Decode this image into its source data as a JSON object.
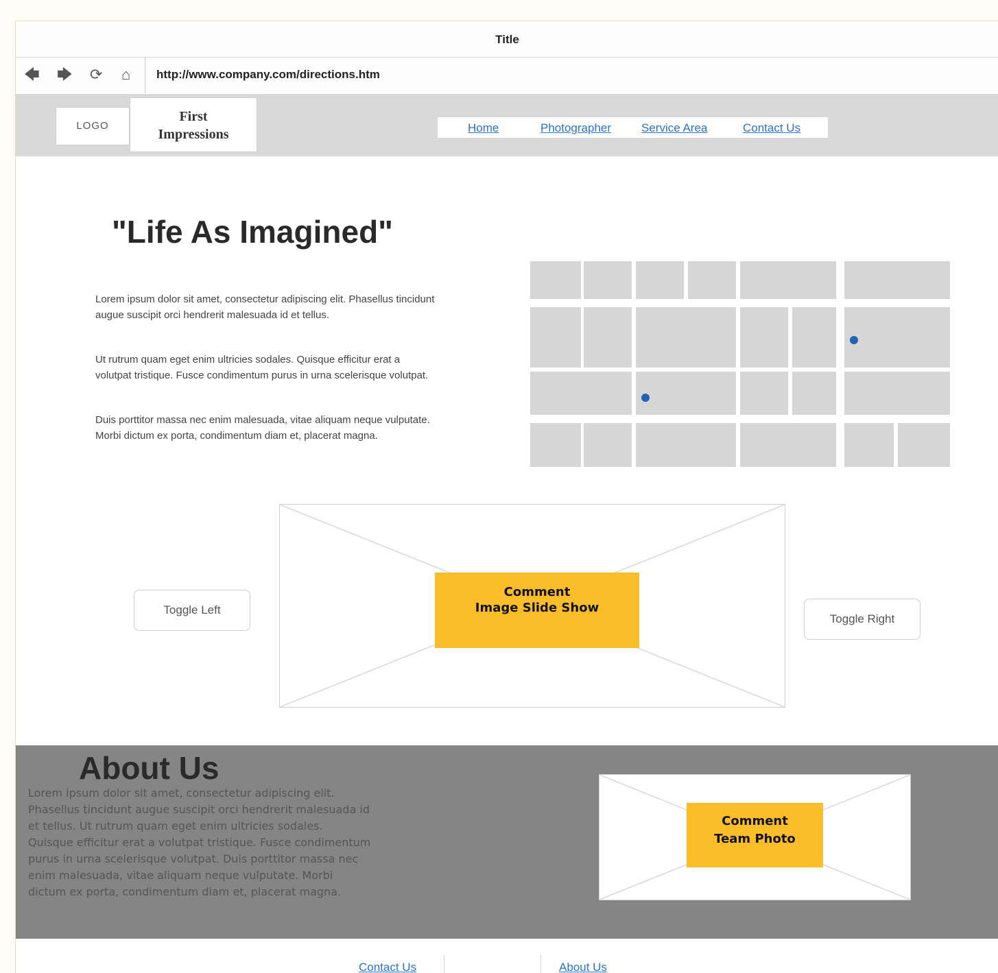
{
  "window": {
    "title": "Title"
  },
  "browser": {
    "url": "http://www.company.com/directions.htm",
    "icons": [
      "back-arrow-icon",
      "forward-arrow-icon",
      "refresh-icon",
      "home-icon"
    ]
  },
  "header": {
    "logo": "LOGO",
    "brand_line1": "First",
    "brand_line2": "Impressions",
    "nav": [
      "Home",
      "Photographer",
      "Service Area",
      "Contact Us"
    ]
  },
  "hero": {
    "headline": "\"Life As Imagined\"",
    "paragraphs": [
      "Lorem ipsum dolor sit amet, consectetur adipiscing elit. Phasellus tincidunt augue suscipit orci hendrerit malesuada id et tellus.",
      "Ut rutrum quam eget enim ultricies sodales. Quisque efficitur erat a volutpat tristique. Fusce condimentum purus in urna scelerisque volutpat.",
      "Duis porttitor massa nec enim malesuada, vitae aliquam neque vulputate. Morbi dictum ex porta, condimentum diam et, placerat magna."
    ]
  },
  "slideshow": {
    "comment_line1": "Comment",
    "comment_line2": "Image Slide Show",
    "toggle_left": "Toggle Left",
    "toggle_right": "Toggle Right"
  },
  "about": {
    "title": "About Us",
    "text": "Lorem ipsum dolor sit amet, consectetur adipiscing elit. Phasellus tincidunt augue suscipit orci hendrerit malesuada id et tellus. Ut rutrum quam eget enim ultricies sodales. Quisque efficitur erat a volutpat tristique. Fusce condimentum purus in urna scelerisque volutpat. Duis porttitor massa nec enim malesuada, vitae aliquam neque vulputate. Morbi dictum ex porta, condimentum diam et, placerat magna.",
    "comment_line1": "Comment",
    "comment_line2": "Team Photo"
  },
  "footer": {
    "links": [
      "Contact Us",
      "About Us"
    ]
  },
  "colors": {
    "accent": "#fbbd28",
    "link": "#2a72c8",
    "map_pin": "#1f63b4",
    "about_bg": "#858585"
  }
}
